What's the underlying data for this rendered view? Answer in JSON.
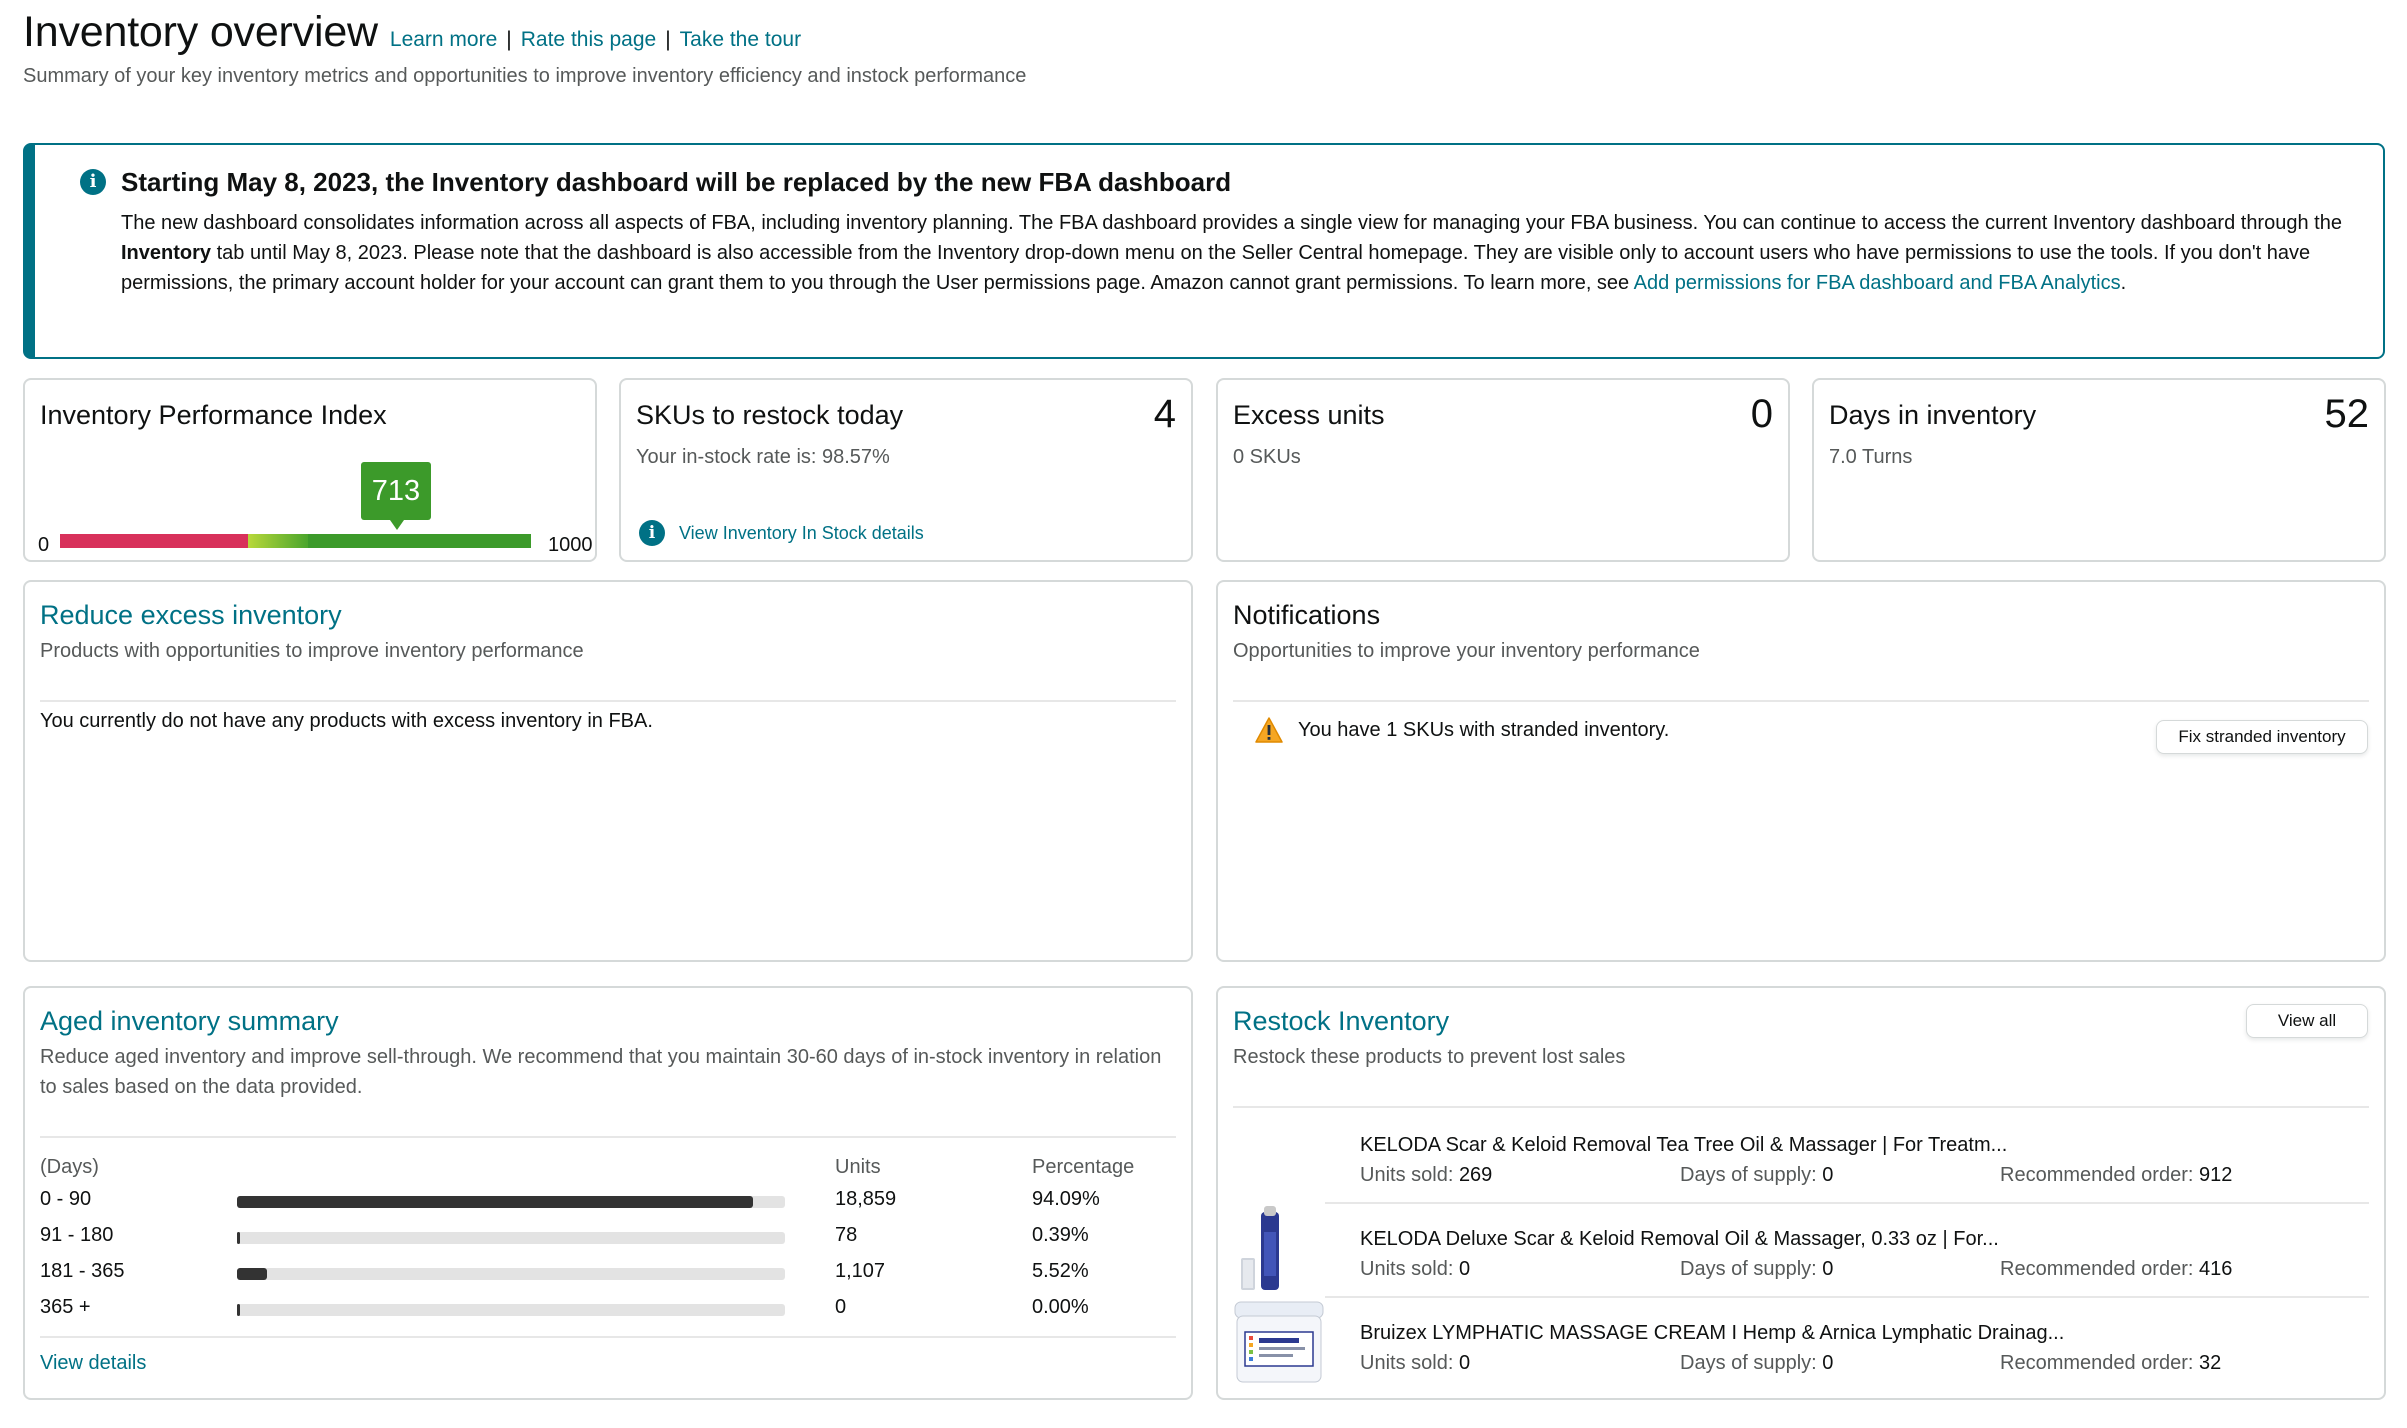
{
  "header": {
    "title": "Inventory overview",
    "links": [
      "Learn more",
      "Rate this page",
      "Take the tour"
    ],
    "separator": "|",
    "subtitle": "Summary of your key inventory metrics and opportunities to improve inventory efficiency and instock performance"
  },
  "alert": {
    "icon": "info-icon",
    "title": "Starting May 8, 2023, the Inventory dashboard will be replaced by the new FBA dashboard",
    "body_1": "The new dashboard consolidates information across all aspects of FBA, including inventory planning. The FBA dashboard provides a single view for managing your FBA business. You can continue to access the current Inventory dashboard through the ",
    "body_bold": "Inventory",
    "body_2": " tab until May 8, 2023. Please note that the dashboard is also accessible from the Inventory drop-down menu on the Seller Central homepage. They are visible only to account users who have permissions to use the tools. If you don't have permissions, the primary account holder for your account can grant them to you through the User permissions page. Amazon cannot grant permissions. To learn more, see ",
    "link": "Add permissions for FBA dashboard and FBA Analytics",
    "body_end": "."
  },
  "metrics": {
    "ipi": {
      "label": "Inventory Performance Index",
      "value": "713",
      "min": "0",
      "max": "1000",
      "score": 713,
      "colors": {
        "low": "#d8315b",
        "mid": "#9ccc3c",
        "high": "#3c9a2a"
      }
    },
    "restock": {
      "label": "SKUs to restock today",
      "value": "4",
      "sub": "Your in-stock rate is: 98.57%",
      "link": "View Inventory In Stock details"
    },
    "excess": {
      "label": "Excess units",
      "value": "0",
      "sub": "0 SKUs"
    },
    "days": {
      "label": "Days in inventory",
      "value": "52",
      "sub": "7.0 Turns"
    }
  },
  "reduce_excess": {
    "title": "Reduce excess inventory",
    "subtitle": "Products with opportunities to improve inventory performance",
    "message": "You currently do not have any products with excess inventory in FBA."
  },
  "notifications": {
    "title": "Notifications",
    "subtitle": "Opportunities to improve your inventory performance",
    "items": [
      {
        "icon": "warning-icon",
        "text": "You have 1 SKUs with stranded inventory.",
        "button": "Fix stranded inventory"
      }
    ]
  },
  "aged": {
    "title": "Aged inventory summary",
    "subtitle": "Reduce aged inventory and improve sell-through. We recommend that you maintain 30-60 days of in-stock inventory in relation to sales based on the data provided.",
    "columns": [
      "(Days)",
      "Units",
      "Percentage"
    ],
    "rows": [
      {
        "range": "0 - 90",
        "units": "18,859",
        "pct": "94.09%",
        "fraction": 0.9409
      },
      {
        "range": "91 - 180",
        "units": "78",
        "pct": "0.39%",
        "fraction": 0.0039
      },
      {
        "range": "181 - 365",
        "units": "1,107",
        "pct": "5.52%",
        "fraction": 0.0552
      },
      {
        "range": "365 +",
        "units": "0",
        "pct": "0.00%",
        "fraction": 0
      }
    ],
    "link": "View details"
  },
  "restock_inventory": {
    "title": "Restock Inventory",
    "subtitle": "Restock these products to prevent lost sales",
    "button": "View all",
    "labels": {
      "sold": "Units sold:",
      "supply": "Days of supply:",
      "order": "Recommended order:"
    },
    "items": [
      {
        "name": "KELODA Scar & Keloid Removal Tea Tree Oil & Massager | For Treatm...",
        "sold": "269",
        "supply": "0",
        "order": "912",
        "image": "none"
      },
      {
        "name": "KELODA Deluxe Scar & Keloid Removal Oil & Massager, 0.33 oz | For...",
        "sold": "0",
        "supply": "0",
        "order": "416",
        "image": "roller-bottle"
      },
      {
        "name": "Bruizex LYMPHATIC MASSAGE CREAM I Hemp & Arnica Lymphatic Drainag...",
        "sold": "0",
        "supply": "0",
        "order": "32",
        "image": "cream-jar"
      }
    ]
  }
}
